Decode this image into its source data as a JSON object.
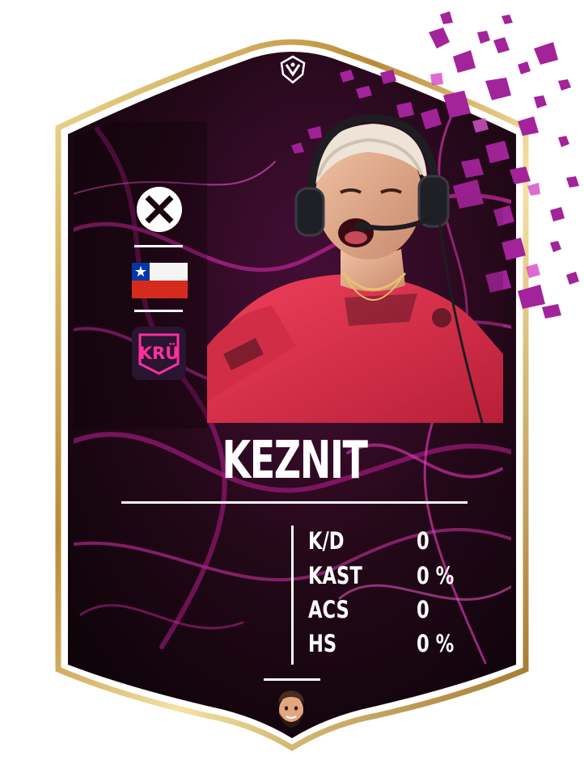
{
  "player": {
    "name": "KEZNIT"
  },
  "stats": [
    {
      "label": "K/D",
      "value": "0"
    },
    {
      "label": "KAST",
      "value": "0 %"
    },
    {
      "label": "ACS",
      "value": "0"
    },
    {
      "label": "HS",
      "value": "0 %"
    }
  ],
  "icons": {
    "top_badge": "valorant-league-badge-icon",
    "platform": "x-icon",
    "flag": "chile-flag-icon",
    "team": "kru-team-logo-icon",
    "avatar": "creator-avatar-icon"
  },
  "team_logo_text": "KRÜ",
  "colors": {
    "gold_frame": "#c9a24a",
    "card_dark": "#150610",
    "magenta": "#e02fb4",
    "jersey": "#e8324f",
    "shard": "#9b1a8a"
  }
}
